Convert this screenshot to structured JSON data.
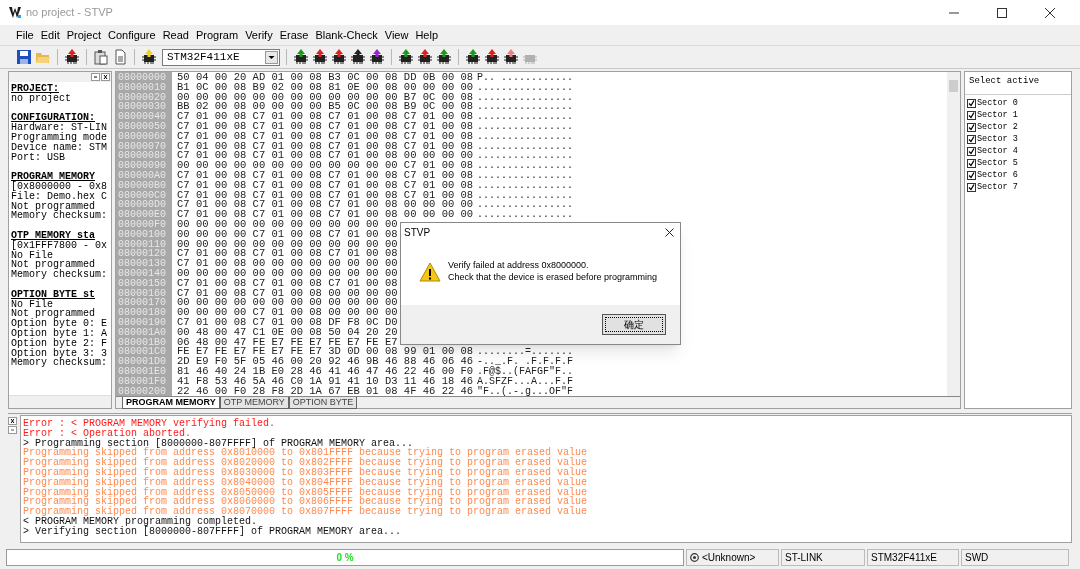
{
  "window": {
    "title": "no project - STVP"
  },
  "menu": [
    "File",
    "Edit",
    "Project",
    "Configure",
    "Read",
    "Program",
    "Verify",
    "Erase",
    "Blank-Check",
    "View",
    "Help"
  ],
  "toolbar": {
    "device": "STM32F411xE"
  },
  "info_panel": [
    {
      "heading": "PROJECT:",
      "lines": [
        "no project"
      ]
    },
    {
      "heading": "CONFIGURATION:",
      "lines": [
        "Hardware: ST-LIN",
        "Programming mode",
        "Device name: STM",
        "Port: USB"
      ]
    },
    {
      "heading": "PROGRAM MEMORY",
      "lines": [
        "[0x8000000 - 0x8",
        "File: Demo.hex C",
        "Not programmed",
        "Memory checksum:"
      ]
    },
    {
      "heading": "OTP MEMORY sta",
      "lines": [
        "[0x1FFF7800 - 0x",
        "No File",
        "Not programmed",
        "Memory checksum:"
      ]
    },
    {
      "heading": "OPTION BYTE st",
      "lines": [
        "No File",
        "Not programmed",
        "Option byte 0: E",
        "Option byte 1: A",
        "Option byte 2: F",
        "Option byte 3: 3",
        "Memory checksum:"
      ]
    }
  ],
  "memory": {
    "rows": [
      {
        "address": "08000000",
        "hex": "50 04 00 20 AD 01 00 08 B3 0C 00 08 DD 0B 00 08",
        "ascii": "P.. ............"
      },
      {
        "address": "08000010",
        "hex": "B1 0C 00 08 B9 02 00 08 81 0E 00 08 00 00 00 00",
        "ascii": "................"
      },
      {
        "address": "08000020",
        "hex": "00 00 00 00 00 00 00 00 00 00 00 00 B7 0C 00 08",
        "ascii": "................"
      },
      {
        "address": "08000030",
        "hex": "BB 02 00 08 00 00 00 00 B5 0C 00 08 B9 0C 00 08",
        "ascii": "................"
      },
      {
        "address": "08000040",
        "hex": "C7 01 00 08 C7 01 00 08 C7 01 00 08 C7 01 00 08",
        "ascii": "................"
      },
      {
        "address": "08000050",
        "hex": "C7 01 00 08 C7 01 00 08 C7 01 00 08 C7 01 00 08",
        "ascii": "................"
      },
      {
        "address": "08000060",
        "hex": "C7 01 00 08 C7 01 00 08 C7 01 00 08 C7 01 00 08",
        "ascii": "................"
      },
      {
        "address": "08000070",
        "hex": "C7 01 00 08 C7 01 00 08 C7 01 00 08 C7 01 00 08",
        "ascii": "................"
      },
      {
        "address": "08000080",
        "hex": "C7 01 00 08 C7 01 00 08 C7 01 00 08 00 00 00 00",
        "ascii": "................"
      },
      {
        "address": "08000090",
        "hex": "00 00 00 00 00 00 00 00 00 00 00 00 C7 01 00 08",
        "ascii": "................"
      },
      {
        "address": "080000A0",
        "hex": "C7 01 00 08 C7 01 00 08 C7 01 00 08 C7 01 00 08",
        "ascii": "................"
      },
      {
        "address": "080000B0",
        "hex": "C7 01 00 08 C7 01 00 08 C7 01 00 08 C7 01 00 08",
        "ascii": "................"
      },
      {
        "address": "080000C0",
        "hex": "C7 01 00 08 C7 01 00 08 C7 01 00 08 C7 01 00 08",
        "ascii": "................"
      },
      {
        "address": "080000D0",
        "hex": "C7 01 00 08 C7 01 00 08 C7 01 00 08 00 00 00 00",
        "ascii": "................"
      },
      {
        "address": "080000E0",
        "hex": "C7 01 00 08 C7 01 00 08 C7 01 00 08 00 00 00 00",
        "ascii": "................"
      },
      {
        "address": "080000F0",
        "hex": "00 00 00 00 00 00 00 00 00 00 00 00"
      },
      {
        "address": "08000100",
        "hex": "00 00 00 00 C7 01 00 08 C7 01 00 08"
      },
      {
        "address": "08000110",
        "hex": "00 00 00 00 00 00 00 00 00 00 00 00"
      },
      {
        "address": "08000120",
        "hex": "C7 01 00 08 C7 01 00 08 C7 01 00 08"
      },
      {
        "address": "08000130",
        "hex": "C7 01 00 08 00 00 00 00 00 00 00 00"
      },
      {
        "address": "08000140",
        "hex": "00 00 00 00 00 00 00 00 00 00 00 00"
      },
      {
        "address": "08000150",
        "hex": "C7 01 00 08 C7 01 00 08 C7 01 00 08"
      },
      {
        "address": "08000160",
        "hex": "C7 01 00 08 C7 01 00 08 00 00 00 00"
      },
      {
        "address": "08000170",
        "hex": "00 00 00 00 00 00 00 00 00 00 00 00"
      },
      {
        "address": "08000180",
        "hex": "00 00 00 00 C7 01 00 08 00 00 00 00"
      },
      {
        "address": "08000190",
        "hex": "C7 01 00 08 C7 01 00 08 DF F8 0C D0"
      },
      {
        "address": "080001A0",
        "hex": "00 48 00 47 C1 0E 00 08 50 04 20 20"
      },
      {
        "address": "080001B0",
        "hex": "06 48 00 47 FE E7 FE E7 FE E7 FE E7"
      },
      {
        "address": "080001C0",
        "hex": "FE E7 FE E7 FE E7 FE E7 3D 0D 00 08 99 01 00 08",
        "ascii": "........=......."
      },
      {
        "address": "080001D0",
        "hex": "2D E9 F0 5F 05 46 00 20 92 46 9B 46 88 46 06 46",
        "ascii": "-.._.F. .F.F.F.F"
      },
      {
        "address": "080001E0",
        "hex": "81 46 40 24 1B E0 28 46 41 46 47 46 22 46 00 F0",
        "ascii": ".F@$..(FAFGF\"F.."
      },
      {
        "address": "080001F0",
        "hex": "41 F8 53 46 5A 46 C0 1A 91 41 10 D3 11 46 18 46",
        "ascii": "A.SFZF...A...F.F"
      },
      {
        "address": "08000200",
        "hex": "22 46 00 F0 28 F8 2D 1A 67 EB 01 08 4F 46 22 46",
        "ascii": "\"F..(.-.g...OF\"F"
      }
    ],
    "tabs": [
      {
        "label": "PROGRAM MEMORY",
        "selected": true
      },
      {
        "label": "OTP MEMORY",
        "selected": false
      },
      {
        "label": "OPTION BYTE",
        "selected": false
      }
    ]
  },
  "sectors": {
    "title": "Select active",
    "items": [
      {
        "label": "Sector 0",
        "checked": true
      },
      {
        "label": "Sector 1",
        "checked": true
      },
      {
        "label": "Sector 2",
        "checked": true
      },
      {
        "label": "Sector 3",
        "checked": true
      },
      {
        "label": "Sector 4",
        "checked": true
      },
      {
        "label": "Sector 5",
        "checked": true
      },
      {
        "label": "Sector 6",
        "checked": true
      },
      {
        "label": "Sector 7",
        "checked": true
      }
    ]
  },
  "log": [
    {
      "kind": "error",
      "text": "Error : < PROGRAM MEMORY verifying failed."
    },
    {
      "kind": "error",
      "text": "Error : < Operation aborted."
    },
    {
      "kind": "info",
      "text": "> Programming section [8000000-807FFFF] of PROGRAM MEMORY area..."
    },
    {
      "kind": "warning",
      "text": "Programming skipped from address 0x8010000 to 0x801FFFF because trying to program erased value"
    },
    {
      "kind": "warning",
      "text": "Programming skipped from address 0x8020000 to 0x802FFFF because trying to program erased value"
    },
    {
      "kind": "warning",
      "text": "Programming skipped from address 0x8030000 to 0x803FFFF because trying to program erased value"
    },
    {
      "kind": "warning",
      "text": "Programming skipped from address 0x8040000 to 0x804FFFF because trying to program erased value"
    },
    {
      "kind": "warning",
      "text": "Programming skipped from address 0x8050000 to 0x805FFFF because trying to program erased value"
    },
    {
      "kind": "warning",
      "text": "Programming skipped from address 0x8060000 to 0x806FFFF because trying to program erased value"
    },
    {
      "kind": "warning",
      "text": "Programming skipped from address 0x8070000 to 0x807FFFF because trying to program erased value"
    },
    {
      "kind": "info",
      "text": "< PROGRAM MEMORY programming completed."
    },
    {
      "kind": "info",
      "text": "> Verifying section [8000000-807FFFF] of PROGRAM MEMORY area..."
    }
  ],
  "dialog": {
    "title": "STVP",
    "message": [
      "Verify failed at address 0x8000000.",
      "Check that the device is erased before programming"
    ],
    "button": "确定"
  },
  "status_bar": {
    "progress": {
      "level": 0,
      "text": "0 %"
    },
    "fields": [
      "<Unknown>",
      "ST-LINK",
      "STM32F411xE",
      "SWD"
    ]
  }
}
